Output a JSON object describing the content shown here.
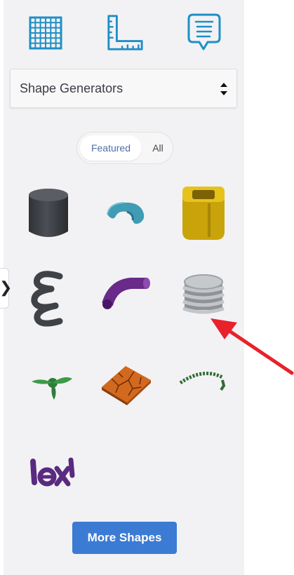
{
  "toolbar": {
    "icons": [
      "grid-icon",
      "ruler-icon",
      "notes-icon"
    ]
  },
  "library": {
    "selected_category": "Shape Generators"
  },
  "toggle": {
    "featured_label": "Featured",
    "all_label": "All",
    "active": "Featured"
  },
  "shapes": [
    "cylinder",
    "torus",
    "tube-box",
    "spring",
    "bent-pipe",
    "threaded-screw",
    "propeller",
    "voronoi-tile",
    "text-arc",
    "text-extrusion"
  ],
  "more_button": {
    "label": "More Shapes"
  },
  "colors": {
    "accent": "#3b7bd4",
    "icon": "#1f8fc6",
    "annotation_arrow": "#e8212b"
  }
}
